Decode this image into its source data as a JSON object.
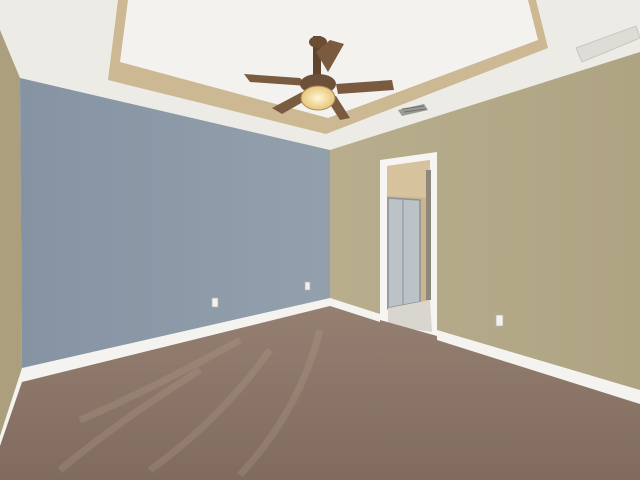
{
  "scene": {
    "colors": {
      "ceiling": "#edebe6",
      "tray_ceiling": "#f3f2ee",
      "tray_trim": "#cdb894",
      "blue_wall": "#8e9aa8",
      "tan_wall": "#b3a887",
      "left_wall": "#ab9f7e",
      "carpet": "#8a7567",
      "baseboard": "#f4f3ef",
      "door_frame": "#f6f5f1",
      "bathroom_wall": "#cdb78e",
      "shower_glass": "#bfc5c8",
      "fan_blade": "#7a5b3f",
      "fan_light": "#f4d98a"
    },
    "icons": [
      "ceiling-fan-icon",
      "hvac-vent-icon",
      "wall-outlet-icon"
    ]
  }
}
